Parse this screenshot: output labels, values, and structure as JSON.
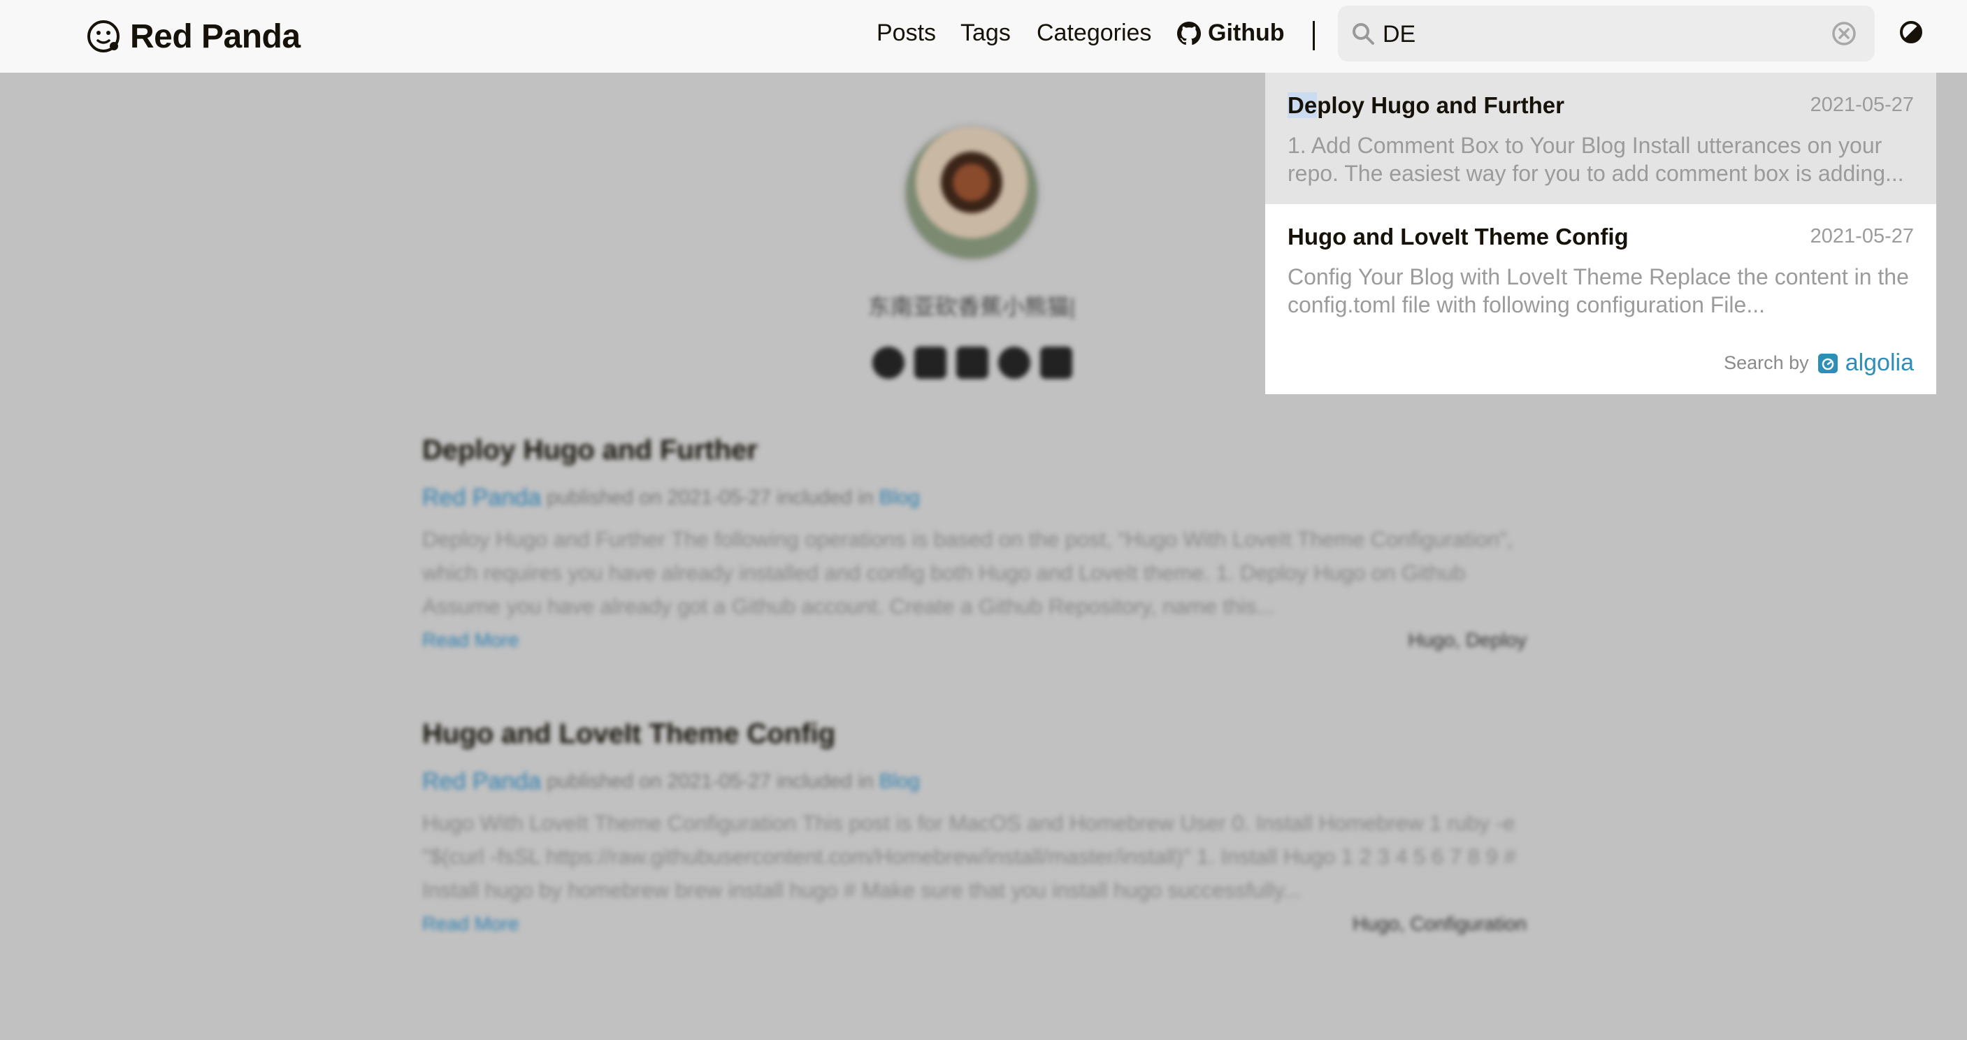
{
  "header": {
    "logo_text": "Red Panda",
    "nav": [
      "Posts",
      "Tags",
      "Categories"
    ],
    "github_label": "Github"
  },
  "search": {
    "value": "DE",
    "results": [
      {
        "title_highlight": "De",
        "title_rest": "ploy Hugo and Further",
        "date": "2021-05-27",
        "description": "1. Add Comment Box to Your Blog Install utterances on your repo. The easiest way for you to add comment box is adding..."
      },
      {
        "title_highlight": "",
        "title_rest": "Hugo and LoveIt Theme Config",
        "date": "2021-05-27",
        "description": "Config Your Blog with LoveIt Theme Replace the content in the config.toml file with following configuration File..."
      }
    ],
    "search_by_label": "Search by",
    "provider": "algolia"
  },
  "profile": {
    "subtitle": "东南亚砍香蕉小熊猫|"
  },
  "posts": [
    {
      "title": "Deploy Hugo and Further",
      "author": "Red Panda",
      "published": "published on 2021-05-27 included in",
      "category": "Blog",
      "summary": "Deploy Hugo and Further The following operations is based on the post, “Hugo With LoveIt Theme Configuration”, which requires you have already installed and config both Hugo and LoveIt theme. 1. Deploy Hugo on Github Assume you have already got a Github account. Create a Github Repository, name this...",
      "read_more": "Read More",
      "tags": "Hugo, Deploy"
    },
    {
      "title": "Hugo and LoveIt Theme Config",
      "author": "Red Panda",
      "published": "published on 2021-05-27 included in",
      "category": "Blog",
      "summary": "Hugo With LoveIt Theme Configuration This post is for MacOS and Homebrew User 0. Install Homebrew 1 ruby -e \"$(curl -fsSL https://raw.githubusercontent.com/Homebrew/install/master/install)\" 1. Install Hugo 1 2 3 4 5 6 7 8 9 # Install hugo by homebrew brew install hugo # Make sure that you install hugo successfully...",
      "read_more": "Read More",
      "tags": "Hugo, Configuration"
    }
  ],
  "colors": {
    "accent": "#2d7fb0",
    "header_bg": "#f8f8f8",
    "overlay_bg": "#c1c1c1",
    "highlight": "#cbdcf0"
  },
  "icons": [
    "logo-icon",
    "github-icon",
    "search-icon",
    "clear-icon",
    "theme-toggle-icon",
    "algolia-icon"
  ]
}
